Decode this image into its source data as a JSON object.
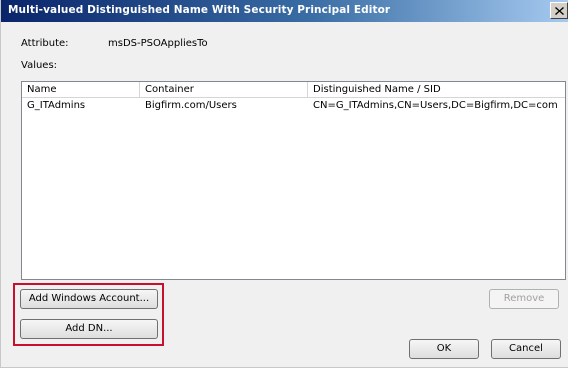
{
  "window": {
    "title": "Multi-valued Distinguished Name With Security Principal Editor",
    "close_icon": "close-icon"
  },
  "attribute": {
    "label": "Attribute:",
    "value": "msDS-PSOAppliesTo"
  },
  "values_label": "Values:",
  "list": {
    "columns": [
      "Name",
      "Container",
      "Distinguished Name / SID"
    ],
    "rows": [
      {
        "name": "G_ITAdmins",
        "container": "Bigfirm.com/Users",
        "dn": "CN=G_ITAdmins,CN=Users,DC=Bigfirm,DC=com"
      }
    ]
  },
  "buttons": {
    "add_windows_account": "Add Windows Account...",
    "add_dn": "Add DN...",
    "remove": "Remove",
    "ok": "OK",
    "cancel": "Cancel"
  },
  "colors": {
    "highlight_border": "#c8102e",
    "titlebar_start": "#0a246a",
    "titlebar_end": "#a6caf0"
  }
}
